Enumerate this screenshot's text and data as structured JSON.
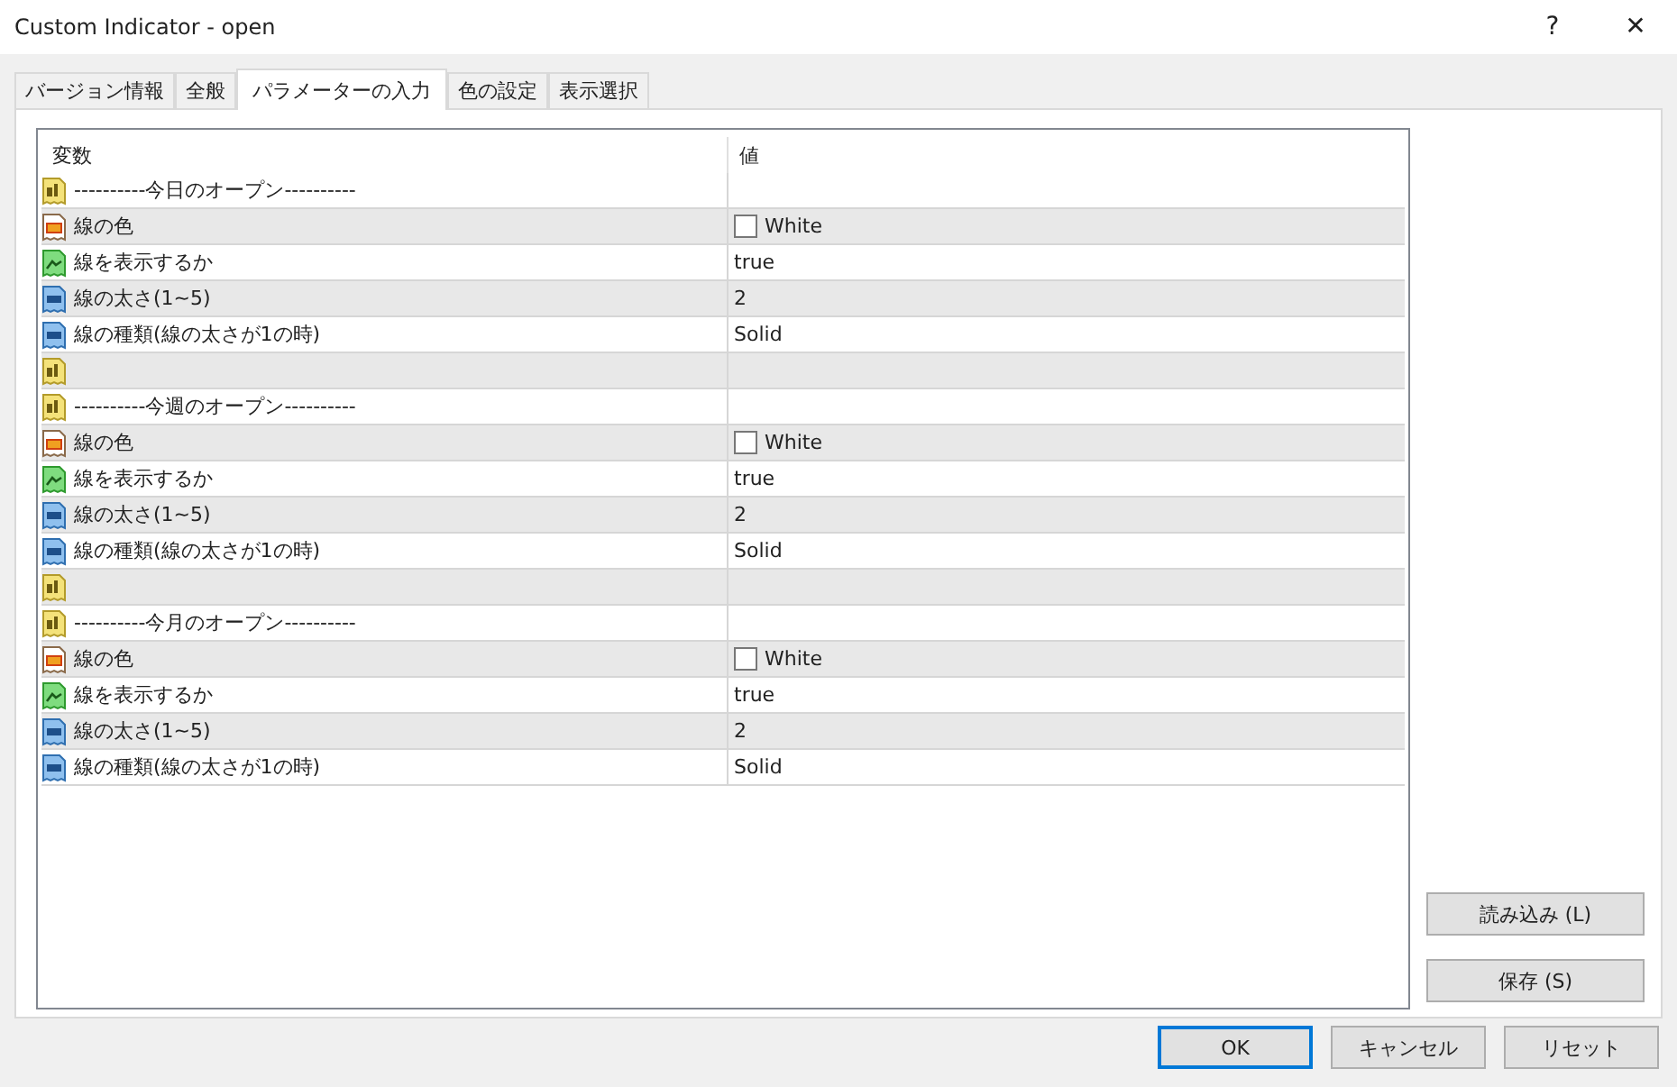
{
  "window": {
    "title": "Custom Indicator - open",
    "help": "?",
    "close": "✕"
  },
  "tabs": [
    {
      "label": "バージョン情報",
      "selected": false
    },
    {
      "label": "全般",
      "selected": false
    },
    {
      "label": "パラメーターの入力",
      "selected": true
    },
    {
      "label": "色の設定",
      "selected": false
    },
    {
      "label": "表示選択",
      "selected": false
    }
  ],
  "table": {
    "columns": [
      "変数",
      "値"
    ],
    "rows": [
      {
        "kind": "string",
        "name": "----------今日のオープン----------"
      },
      {
        "kind": "color",
        "name": "線の色",
        "value": "White",
        "color": "#ffffff"
      },
      {
        "kind": "bool",
        "name": "線を表示するか",
        "value": "true"
      },
      {
        "kind": "int",
        "name": "線の太さ(1~5)",
        "value": "2"
      },
      {
        "kind": "int",
        "name": "線の種類(線の太さが1の時)",
        "value": "Solid"
      },
      {
        "kind": "string"
      },
      {
        "kind": "string",
        "name": "----------今週のオープン----------"
      },
      {
        "kind": "color",
        "name": "線の色",
        "value": "White",
        "color": "#ffffff"
      },
      {
        "kind": "bool",
        "name": "線を表示するか",
        "value": "true"
      },
      {
        "kind": "int",
        "name": "線の太さ(1~5)",
        "value": "2"
      },
      {
        "kind": "int",
        "name": "線の種類(線の太さが1の時)",
        "value": "Solid"
      },
      {
        "kind": "string"
      },
      {
        "kind": "string",
        "name": "----------今月のオープン----------"
      },
      {
        "kind": "color",
        "name": "線の色",
        "value": "White",
        "color": "#ffffff"
      },
      {
        "kind": "bool",
        "name": "線を表示するか",
        "value": "true"
      },
      {
        "kind": "int",
        "name": "線の太さ(1~5)",
        "value": "2"
      },
      {
        "kind": "int",
        "name": "線の種類(線の太さが1の時)",
        "value": "Solid"
      }
    ]
  },
  "side_buttons": [
    "読み込み (L)",
    "保存 (S)"
  ],
  "buttons": [
    {
      "label": "OK",
      "default": true
    },
    {
      "label": "キャンセル",
      "default": false
    },
    {
      "label": "リセット",
      "default": false
    }
  ]
}
